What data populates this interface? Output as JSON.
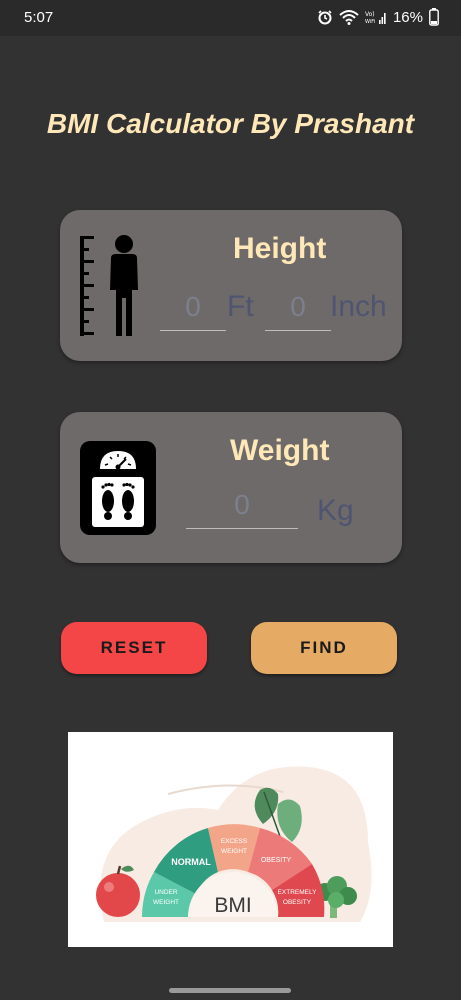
{
  "status": {
    "time": "5:07",
    "battery": "16%",
    "icons": [
      "alarm-icon",
      "wifi-icon",
      "signal-icon",
      "battery-icon"
    ]
  },
  "app": {
    "title": "BMI Calculator By Prashant"
  },
  "height_card": {
    "title": "Height",
    "feet_value": "0",
    "feet_unit": "Ft",
    "inch_value": "0",
    "inch_unit": "Inch",
    "icon": "height-person-icon"
  },
  "weight_card": {
    "title": "Weight",
    "value": "0",
    "unit": "Kg",
    "icon": "weighing-scale-icon"
  },
  "buttons": {
    "reset_label": "RESET",
    "find_label": "FIND"
  },
  "banner": {
    "center_label": "BMI",
    "segments": [
      "UNDER WEIGHT",
      "NORMAL",
      "EXCESS WEIGHT",
      "OBESITY",
      "EXTREMELY OBESITY"
    ]
  },
  "colors": {
    "background": "#333233",
    "card": "#6e6a69",
    "title": "#ffe8b8",
    "reset": "#f44646",
    "find": "#e5ab64"
  }
}
